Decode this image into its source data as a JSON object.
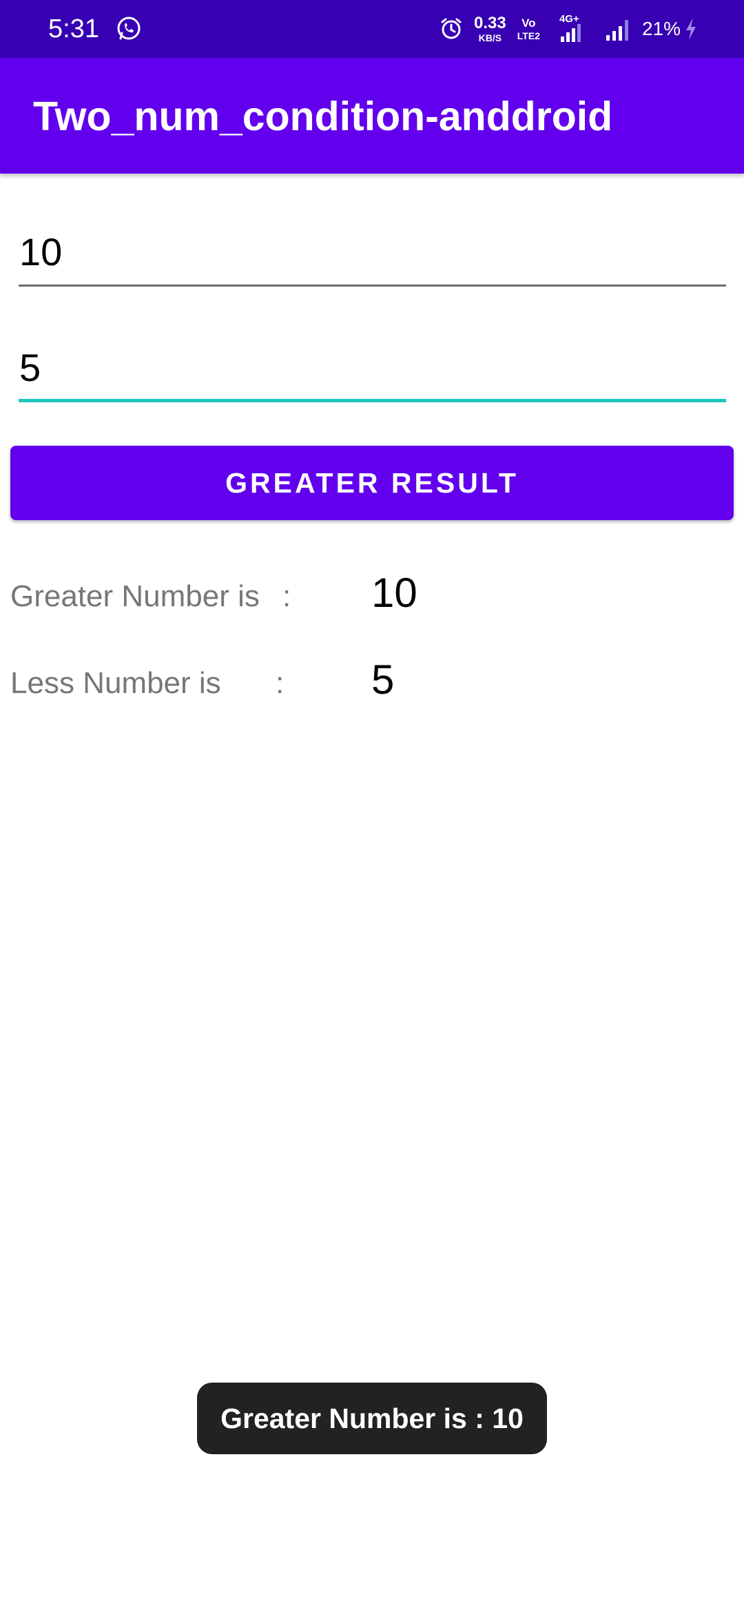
{
  "status_bar": {
    "time": "5:31",
    "network_speed_value": "0.33",
    "network_speed_unit": "KB/S",
    "volte_top": "Vo",
    "volte_bottom": "LTE2",
    "network_type": "4G+",
    "battery_percent": "21%",
    "icons": [
      "whatsapp-icon",
      "alarm-icon",
      "signal-4g-icon",
      "signal-icon",
      "charging-icon"
    ]
  },
  "app_bar": {
    "title": "Two_num_condition-anddroid"
  },
  "inputs": {
    "first_number": "10",
    "second_number": "5"
  },
  "button": {
    "label": "GREATER RESULT"
  },
  "results": {
    "greater_label": "Greater Number is",
    "greater_colon": ":",
    "greater_value": "10",
    "less_label": "Less Number is",
    "less_colon": ":",
    "less_value": "5"
  },
  "toast": {
    "message": "Greater Number is : 10"
  },
  "colors": {
    "status_bar": "#3700b3",
    "primary": "#6200ee",
    "focus_underline": "#1ec8c0",
    "toast_bg": "#222222"
  }
}
